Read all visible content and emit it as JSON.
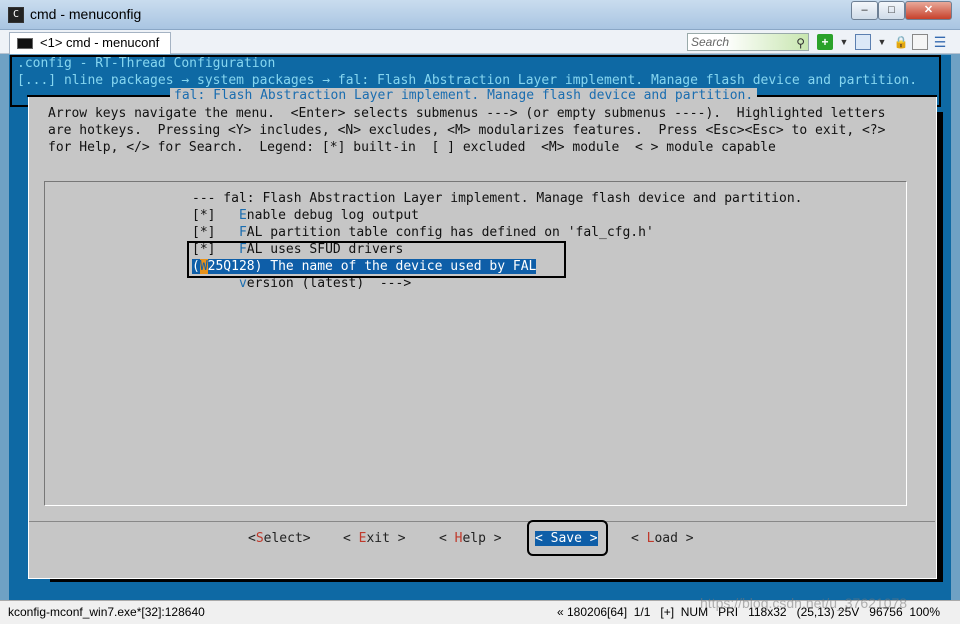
{
  "window": {
    "title": "cmd - menuconfig",
    "minimize": "0",
    "maximize": "1",
    "close": "r"
  },
  "tabs": [
    {
      "label": "<1> cmd - menuconf"
    }
  ],
  "toolbar": {
    "search_placeholder": "Search"
  },
  "terminal": {
    "line1": ".config - RT-Thread Configuration",
    "line2": "[...] nline packages → system packages → fal: Flash Abstraction Layer implement. Manage flash device and partition.",
    "dialog_title": "fal: Flash Abstraction Layer implement. Manage flash device and partition.",
    "help": [
      "Arrow keys navigate the menu.  <Enter> selects submenus ---> (or empty submenus ----).  Highlighted letters",
      "are hotkeys.  Pressing <Y> includes, <N> excludes, <M> modularizes features.  Press <Esc><Esc> to exit, <?>",
      "for Help, </> for Search.  Legend: [*] built-in  [ ] excluded  <M> module  < > module capable"
    ],
    "menu": {
      "header": "--- fal: Flash Abstraction Layer implement. Manage flash device and partition.",
      "items": [
        {
          "prefix": "[*]   ",
          "hotkey": "E",
          "rest": "nable debug log output"
        },
        {
          "prefix": "[*]   ",
          "hotkey": "F",
          "rest": "AL partition table config has defined on 'fal_cfg.h'"
        },
        {
          "prefix": "[*]   ",
          "hotkey": "F",
          "rest": "AL uses SFUD drivers"
        },
        {
          "prefix": "(",
          "hotkey": "W",
          "rest": "25Q128) The name of the device used by FAL"
        },
        {
          "prefix": "      ",
          "hotkey": "v",
          "rest": "ersion (latest)  --->"
        }
      ]
    },
    "buttons": [
      {
        "pre": "<",
        "hotkey": "S",
        "rest": "elect>"
      },
      {
        "pre": "< ",
        "hotkey": "E",
        "rest": "xit >"
      },
      {
        "pre": "< ",
        "hotkey": "H",
        "rest": "elp >"
      },
      {
        "pre": "< ",
        "hotkey": "S",
        "rest": "ave >"
      },
      {
        "pre": "< ",
        "hotkey": "L",
        "rest": "oad >"
      }
    ]
  },
  "status": {
    "left": "kconfig-mconf_win7.exe*[32]:128640",
    "right": "« 180206[64]  1/1   [+]  NUM   PRI   118x32   (25,13) 25V   96756  100%"
  },
  "watermark": "https://blog.csdn.net/u_37621078"
}
